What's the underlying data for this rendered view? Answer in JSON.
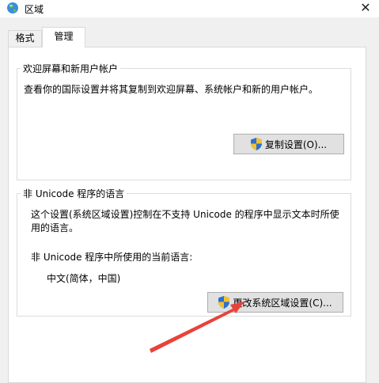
{
  "window": {
    "title": "区域",
    "close_glyph": "✕",
    "icon": "globe-icon"
  },
  "tabs": [
    {
      "label": "格式",
      "active": false
    },
    {
      "label": "管理",
      "active": true
    }
  ],
  "welcome_section": {
    "heading": "欢迎屏幕和新用户帐户",
    "description": "查看你的国际设置并将其复制到欢迎屏幕、系统帐户和新的用户帐户。",
    "button_label": "复制设置(O)...",
    "button_icon": "uac-shield-icon"
  },
  "unicode_section": {
    "heading": "非 Unicode 程序的语言",
    "description_line1": "这个设置(系统区域设置)控制在不支持 Unicode 的程序中显示文本时所使",
    "description_line2": "用的语言。",
    "current_label": "非 Unicode 程序中所使用的当前语言:",
    "current_value": "中文(简体，中国)",
    "button_label": "更改系统区域设置(C)...",
    "button_icon": "uac-shield-icon"
  },
  "annotation": {
    "type": "red-arrow",
    "color": "#e8433a",
    "points_to": "change-locale-button"
  },
  "colors": {
    "window_bg": "#f0f0f0",
    "panel_bg": "#ffffff",
    "button_bg": "#e1e1e1",
    "button_border": "#adadad",
    "arrow": "#e8433a"
  }
}
